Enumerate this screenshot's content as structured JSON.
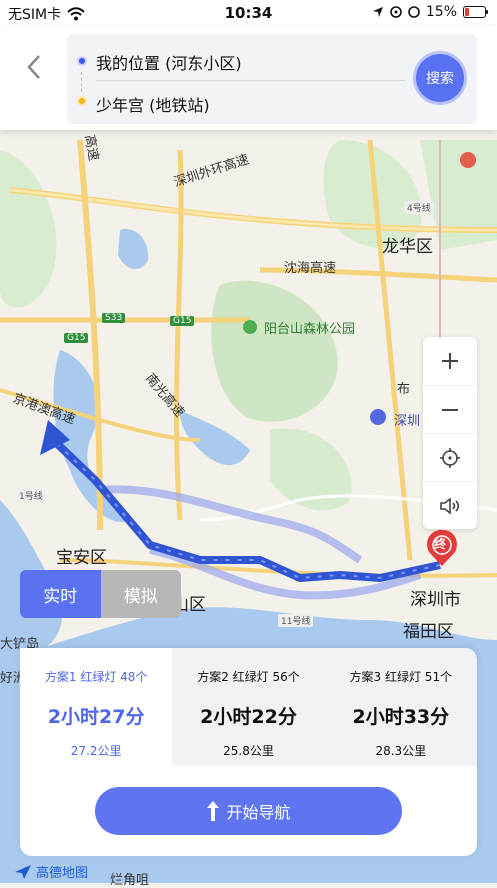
{
  "status": {
    "carrier": "无SIM卡",
    "time": "10:34",
    "battery": "15%"
  },
  "route": {
    "from": "我的位置 (河东小区)",
    "to": "少年宫 (地铁站)",
    "search_label": "搜索"
  },
  "map": {
    "labels": [
      "深圳外环高速",
      "龙华区",
      "沈海高速",
      "阳台山森林公园",
      "南光高速",
      "京港澳高速",
      "宝安区",
      "山区",
      "深圳市",
      "福田区",
      "大铲岛",
      "深圳",
      "布",
      "高速",
      "好洲",
      "烂角咀"
    ],
    "road_signs": [
      "S33",
      "G15",
      "G15",
      "4号线",
      "1号线",
      "11号线"
    ],
    "end_marker": "终"
  },
  "mode": {
    "realtime": "实时",
    "simulate": "模拟"
  },
  "plans": [
    {
      "meta": "方案1  红绿灯 48个",
      "time": "2小时27分",
      "distance": "27.2公里"
    },
    {
      "meta": "方案2  红绿灯 56个",
      "time": "2小时22分",
      "distance": "25.8公里"
    },
    {
      "meta": "方案3  红绿灯 51个",
      "time": "2小时33分",
      "distance": "28.3公里"
    }
  ],
  "start_nav": "开始导航",
  "logo_text": "高德地图",
  "colors": {
    "accent": "#5a72f2",
    "route": "#3c5bd6"
  }
}
